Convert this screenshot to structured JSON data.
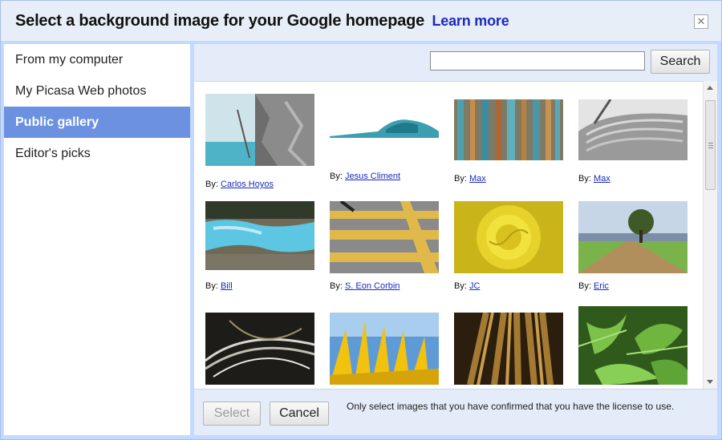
{
  "dialog": {
    "title": "Select a background image for your Google homepage",
    "learn_more": "Learn more",
    "close_glyph": "✕"
  },
  "sidebar": {
    "items": [
      {
        "label": "From my computer",
        "selected": false
      },
      {
        "label": "My Picasa Web photos",
        "selected": false
      },
      {
        "label": "Public gallery",
        "selected": true
      },
      {
        "label": "Editor's picks",
        "selected": false
      }
    ]
  },
  "search": {
    "value": "",
    "placeholder": "",
    "button_label": "Search"
  },
  "gallery": {
    "by_prefix": "By:",
    "photos": [
      {
        "author": "Carlos Hoyos",
        "subject": "tree-trunk-over-lake"
      },
      {
        "author": "Jesus Climent",
        "subject": "turquoise-wave-rock"
      },
      {
        "author": "Max",
        "subject": "weathered-wood-planks"
      },
      {
        "author": "Max",
        "subject": "horse-mane-closeup"
      },
      {
        "author": "Bill",
        "subject": "turquoise-terraced-pools"
      },
      {
        "author": "S. Eon Corbin",
        "subject": "crosswalk-stripes"
      },
      {
        "author": "JC",
        "subject": "yellow-rose"
      },
      {
        "author": "Eric",
        "subject": "lone-tree-field"
      },
      {
        "author": "",
        "subject": "white-fibers-dark"
      },
      {
        "author": "",
        "subject": "sunflower-petals-sky"
      },
      {
        "author": "",
        "subject": "wheat-stalks-brown"
      },
      {
        "author": "",
        "subject": "green-leaves"
      }
    ]
  },
  "footer": {
    "select_label": "Select",
    "cancel_label": "Cancel",
    "license_note": "Only select images that you have confirmed that you have the license to use."
  },
  "colors": {
    "dialog_bg": "#c3d9ff",
    "selected_item": "#6b91e0",
    "link": "#1b2bbd"
  }
}
